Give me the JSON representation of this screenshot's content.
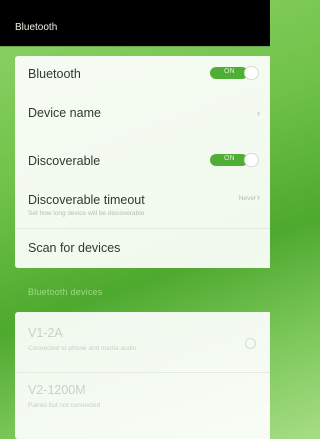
{
  "header": {
    "title": "Bluetooth"
  },
  "settings": {
    "bluetooth_label": "Bluetooth",
    "bluetooth_toggle_text": "ON",
    "device_name_label": "Device name",
    "discoverable_label": "Discoverable",
    "discoverable_toggle_text": "ON",
    "timeout_label": "Discoverable timeout",
    "timeout_subtext": "Set how long device will be discoverable",
    "timeout_value": "Never",
    "scan_label": "Scan for devices"
  },
  "section": {
    "title": "Bluetooth devices"
  },
  "devices": [
    {
      "name": "V1-2A",
      "status": "Connected to phone and media audio"
    },
    {
      "name": "V2-1200M",
      "status": "Paired but not connected"
    }
  ],
  "colors": {
    "accent": "#4fae35",
    "header_bg": "#000000"
  },
  "icons": {
    "chevron": "chevron-right-icon",
    "info": "info-icon"
  }
}
